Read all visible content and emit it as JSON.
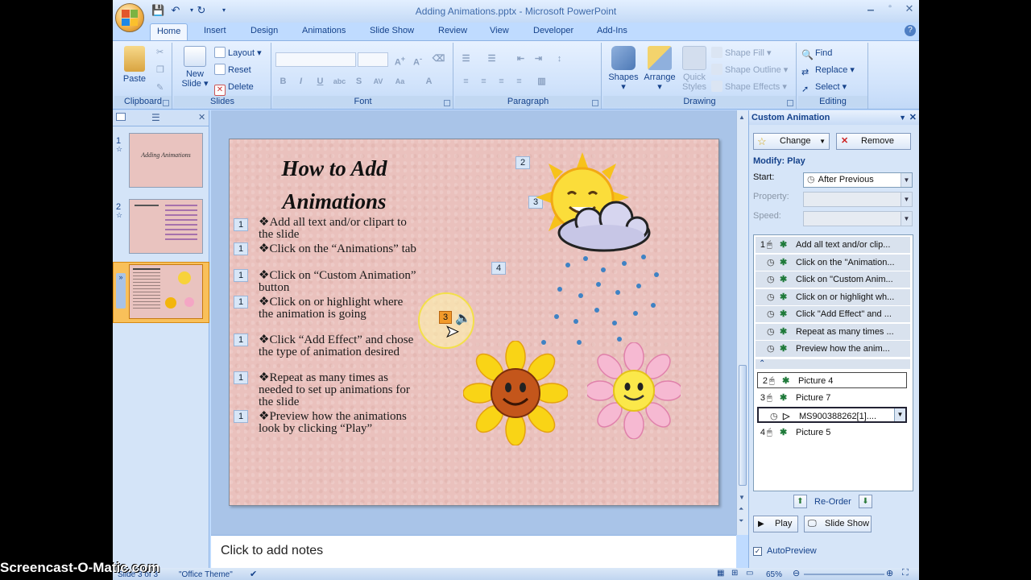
{
  "window": {
    "title": "Adding Animations.pptx - Microsoft PowerPoint"
  },
  "tabs": [
    "Home",
    "Insert",
    "Design",
    "Animations",
    "Slide Show",
    "Review",
    "View",
    "Developer",
    "Add-Ins"
  ],
  "ribbon": {
    "clipboard": {
      "label": "Clipboard",
      "paste": "Paste"
    },
    "slides": {
      "label": "Slides",
      "new_slide_l1": "New",
      "new_slide_l2": "Slide",
      "layout": "Layout",
      "reset": "Reset",
      "delete": "Delete"
    },
    "font": {
      "label": "Font"
    },
    "paragraph": {
      "label": "Paragraph"
    },
    "drawing": {
      "label": "Drawing",
      "shapes": "Shapes",
      "arrange": "Arrange",
      "quick_styles_l1": "Quick",
      "quick_styles_l2": "Styles",
      "shape_fill": "Shape Fill",
      "shape_outline": "Shape Outline",
      "shape_effects": "Shape Effects"
    },
    "editing": {
      "label": "Editing",
      "find": "Find",
      "replace": "Replace",
      "select": "Select"
    }
  },
  "thumbnails": [
    {
      "num": "1",
      "title": "Adding Animations"
    },
    {
      "num": "2",
      "title": ""
    },
    {
      "num": "3",
      "title": ""
    }
  ],
  "slide": {
    "title_l1": "How to Add",
    "title_l2": "Animations",
    "tags": {
      "sun": "2",
      "cloud": "3",
      "rain": "4",
      "sound": "3"
    },
    "bullets": [
      {
        "tag": "1",
        "text": "❖Add all text and/or clipart to the slide"
      },
      {
        "tag": "1",
        "text": "❖Click on the “Animations” tab"
      },
      {
        "tag": "1",
        "text": "❖Click on “Custom Animation” button"
      },
      {
        "tag": "1",
        "text": "❖Click on or highlight where the animation is going"
      },
      {
        "tag": "1",
        "text": "❖Click “Add Effect” and chose the type of animation desired"
      },
      {
        "tag": "1",
        "text": "❖Repeat as many times as needed to set up animations for the slide"
      },
      {
        "tag": "1",
        "text": "❖Preview how the animations look by clicking “Play”"
      }
    ]
  },
  "notes": {
    "placeholder": "Click to add notes"
  },
  "status": {
    "slide": "Slide 3 of 3",
    "theme": "\"Office Theme\"",
    "zoom": "65%"
  },
  "taskpane": {
    "title": "Custom Animation",
    "change": "Change",
    "remove": "Remove",
    "modify": "Modify: Play",
    "start_label": "Start:",
    "start_value": "After Previous",
    "property_label": "Property:",
    "speed_label": "Speed:",
    "list": [
      {
        "num": "1",
        "text": "Add all text and/or clip..."
      },
      {
        "num": "",
        "text": "Click on the \"Animation..."
      },
      {
        "num": "",
        "text": "Click on \"Custom Anim..."
      },
      {
        "num": "",
        "text": "Click on or highlight wh..."
      },
      {
        "num": "",
        "text": "Click \"Add Effect\" and ..."
      },
      {
        "num": "",
        "text": "Repeat as many times ..."
      },
      {
        "num": "",
        "text": "Preview how the anim..."
      }
    ],
    "list2": [
      {
        "num": "2",
        "text": "Picture 4"
      },
      {
        "num": "3",
        "text": "Picture 7"
      },
      {
        "num": "",
        "text": "MS900388262[1]...."
      },
      {
        "num": "4",
        "text": "Picture 5"
      }
    ],
    "reorder": "Re-Order",
    "play": "Play",
    "slideshow": "Slide Show",
    "autopreview": "AutoPreview"
  },
  "watermark": "Screencast-O-Matic.com"
}
